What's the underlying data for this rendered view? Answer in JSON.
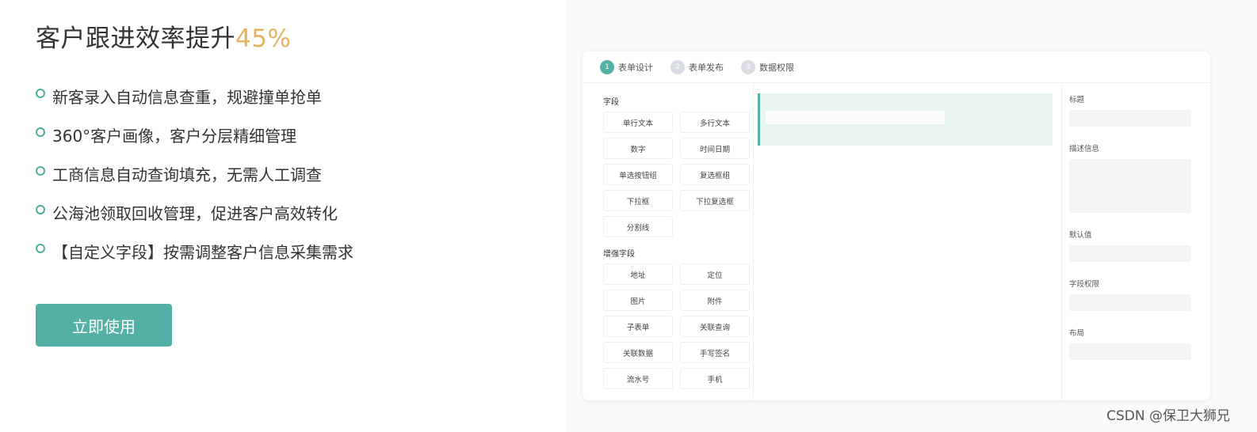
{
  "promo": {
    "title_main": "客户跟进效率提升",
    "title_accent": "45%",
    "features": [
      "新客录入自动信息查重，规避撞单抢单",
      "360°客户画像，客户分层精细管理",
      "工商信息自动查询填充，无需人工调查",
      "公海池领取回收管理，促进客户高效转化",
      "【自定义字段】按需调整客户信息采集需求"
    ],
    "cta_label": "立即使用"
  },
  "preview": {
    "steps": [
      {
        "num": "1",
        "label": "表单设计"
      },
      {
        "num": "2",
        "label": "表单发布"
      },
      {
        "num": "3",
        "label": "数据权限"
      }
    ],
    "fields_title": "字段",
    "fields": [
      "单行文本",
      "多行文本",
      "数字",
      "时间日期",
      "单选按钮组",
      "复选框组",
      "下拉框",
      "下拉复选框",
      "分割线"
    ],
    "enhanced_title": "增强字段",
    "enhanced": [
      "地址",
      "定位",
      "图片",
      "附件",
      "子表单",
      "关联查询",
      "关联数据",
      "手写签名",
      "流水号",
      "手机"
    ],
    "props": {
      "title": "标题",
      "description": "描述信息",
      "default": "默认值",
      "permission": "字段权限",
      "layout": "布局"
    }
  },
  "watermark": "CSDN @保卫大狮兄",
  "colors": {
    "accent": "#54b0a4",
    "highlight": "#e6b45e"
  }
}
